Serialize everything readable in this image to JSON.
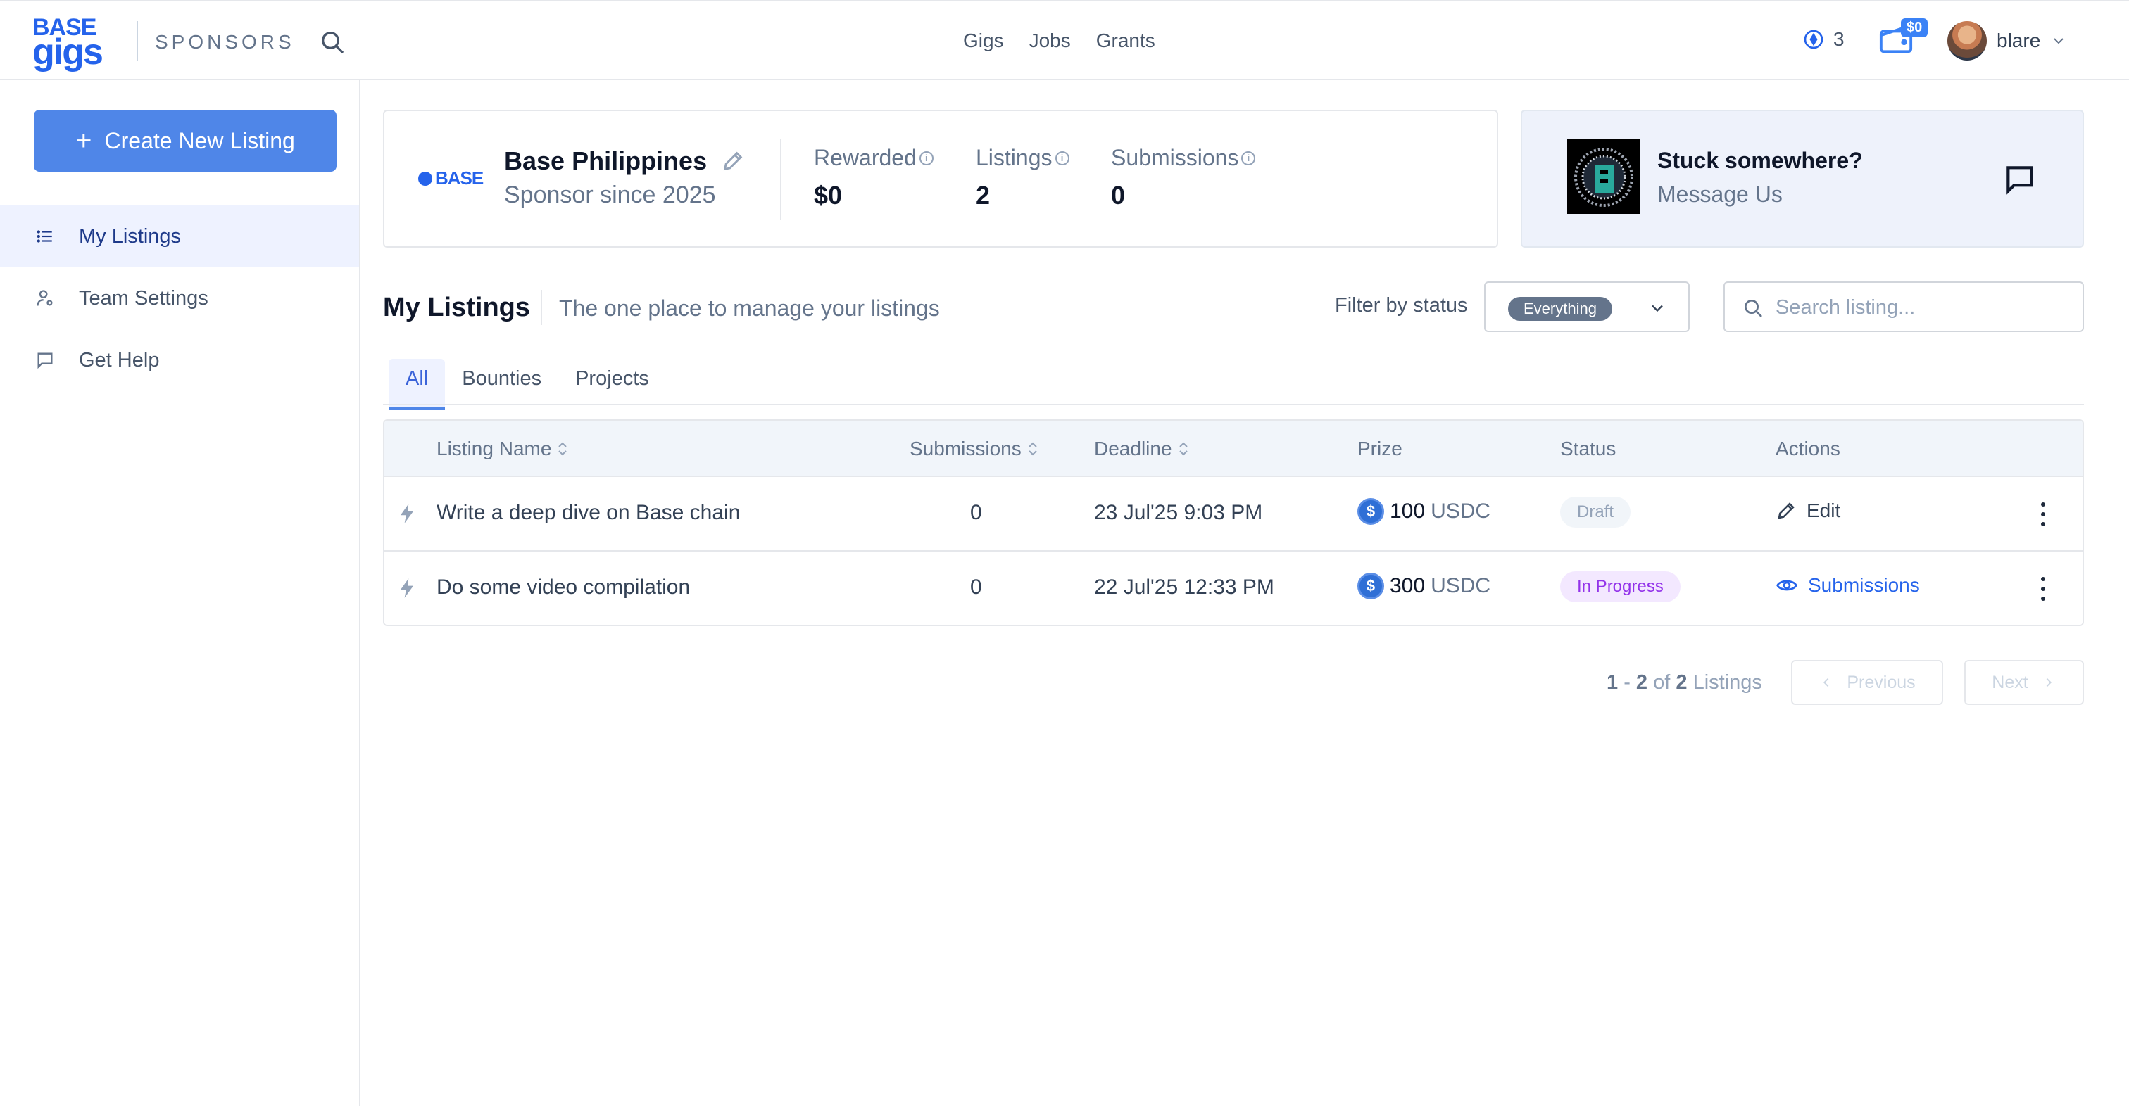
{
  "topnav": {
    "logo_line1": "BASE",
    "logo_line2": "gigs",
    "section_label": "SPONSORS",
    "links": [
      "Gigs",
      "Jobs",
      "Grants"
    ],
    "points": "3",
    "wallet_badge": "$0",
    "username": "blare"
  },
  "sidebar": {
    "create_label": "Create New Listing",
    "items": [
      {
        "label": "My Listings",
        "icon": "list-icon"
      },
      {
        "label": "Team Settings",
        "icon": "user-cog-icon"
      },
      {
        "label": "Get Help",
        "icon": "message-icon"
      }
    ]
  },
  "sponsor": {
    "logo_text": "BASE",
    "name": "Base Philippines",
    "since": "Sponsor since 2025",
    "stats": [
      {
        "label": "Rewarded",
        "value": "$0"
      },
      {
        "label": "Listings",
        "value": "2"
      },
      {
        "label": "Submissions",
        "value": "0"
      }
    ]
  },
  "help": {
    "title": "Stuck somewhere?",
    "subtitle": "Message Us"
  },
  "listings": {
    "title": "My Listings",
    "subtitle": "The one place to manage your listings",
    "filter_label": "Filter by status",
    "filter_value": "Everything",
    "search_placeholder": "Search listing...",
    "tabs": [
      "All",
      "Bounties",
      "Projects"
    ],
    "columns": [
      "Listing Name",
      "Submissions",
      "Deadline",
      "Prize",
      "Status",
      "Actions"
    ],
    "rows": [
      {
        "name": "Write a deep dive on Base chain",
        "submissions": "0",
        "deadline": "23 Jul'25 9:03 PM",
        "prize_amount": "100",
        "prize_currency": "USDC",
        "status": "Draft",
        "action": "Edit"
      },
      {
        "name": "Do some video compilation",
        "submissions": "0",
        "deadline": "22 Jul'25 12:33 PM",
        "prize_amount": "300",
        "prize_currency": "USDC",
        "status": "In Progress",
        "action": "Submissions"
      }
    ],
    "pagination": {
      "range_start": "1",
      "range_end": "2",
      "total": "2",
      "of_label": "of",
      "items_label": "Listings",
      "previous": "Previous",
      "next": "Next"
    }
  },
  "colors": {
    "brand": "#2563eb",
    "primary_button": "#4f86e8",
    "active_nav_bg": "#eef2ff",
    "draft_badge": "#f1f5f9",
    "progress_badge": "#f3e8ff"
  }
}
